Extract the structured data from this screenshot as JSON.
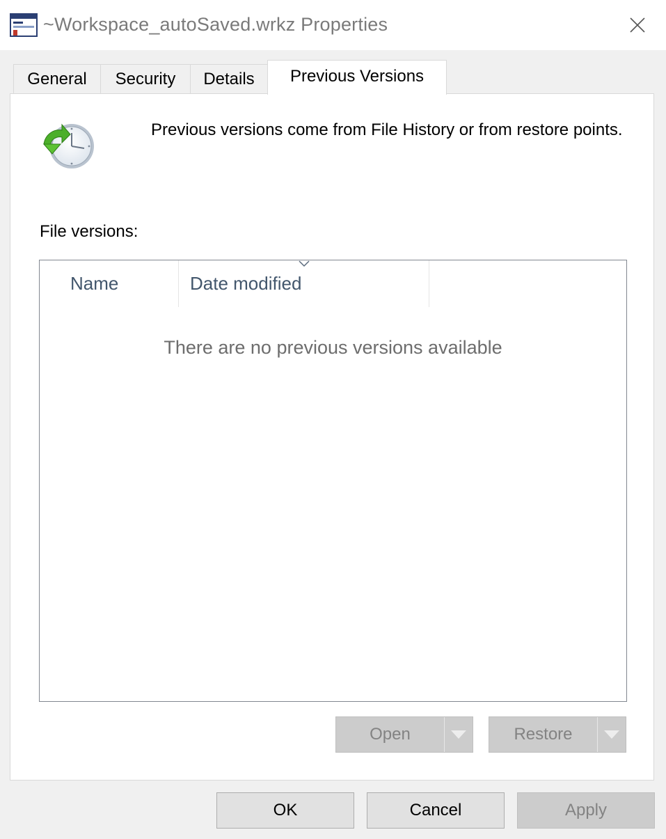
{
  "window": {
    "title": "~Workspace_autoSaved.wrkz Properties",
    "icon": "properties-window-icon",
    "close_icon": "close-icon"
  },
  "tabs": [
    {
      "label": "General",
      "active": false
    },
    {
      "label": "Security",
      "active": false
    },
    {
      "label": "Details",
      "active": false
    },
    {
      "label": "Previous Versions",
      "active": true
    }
  ],
  "panel": {
    "icon": "history-clock-icon",
    "info_text": "Previous versions come from File History or from restore points.",
    "versions_label": "File versions:",
    "list": {
      "columns": [
        "Name",
        "Date modified"
      ],
      "sorted_column": "Date modified",
      "empty_message": "There are no previous versions available"
    },
    "buttons": {
      "open": {
        "label": "Open",
        "enabled": false
      },
      "restore": {
        "label": "Restore",
        "enabled": false
      }
    }
  },
  "footer": {
    "ok": "OK",
    "cancel": "Cancel",
    "apply": "Apply",
    "apply_enabled": false
  },
  "colors": {
    "title_text": "#7a7a7a",
    "header_text": "#42566c",
    "disabled_bg": "#cccccc",
    "disabled_text": "#838383",
    "clock_green": "#4caf2a"
  }
}
